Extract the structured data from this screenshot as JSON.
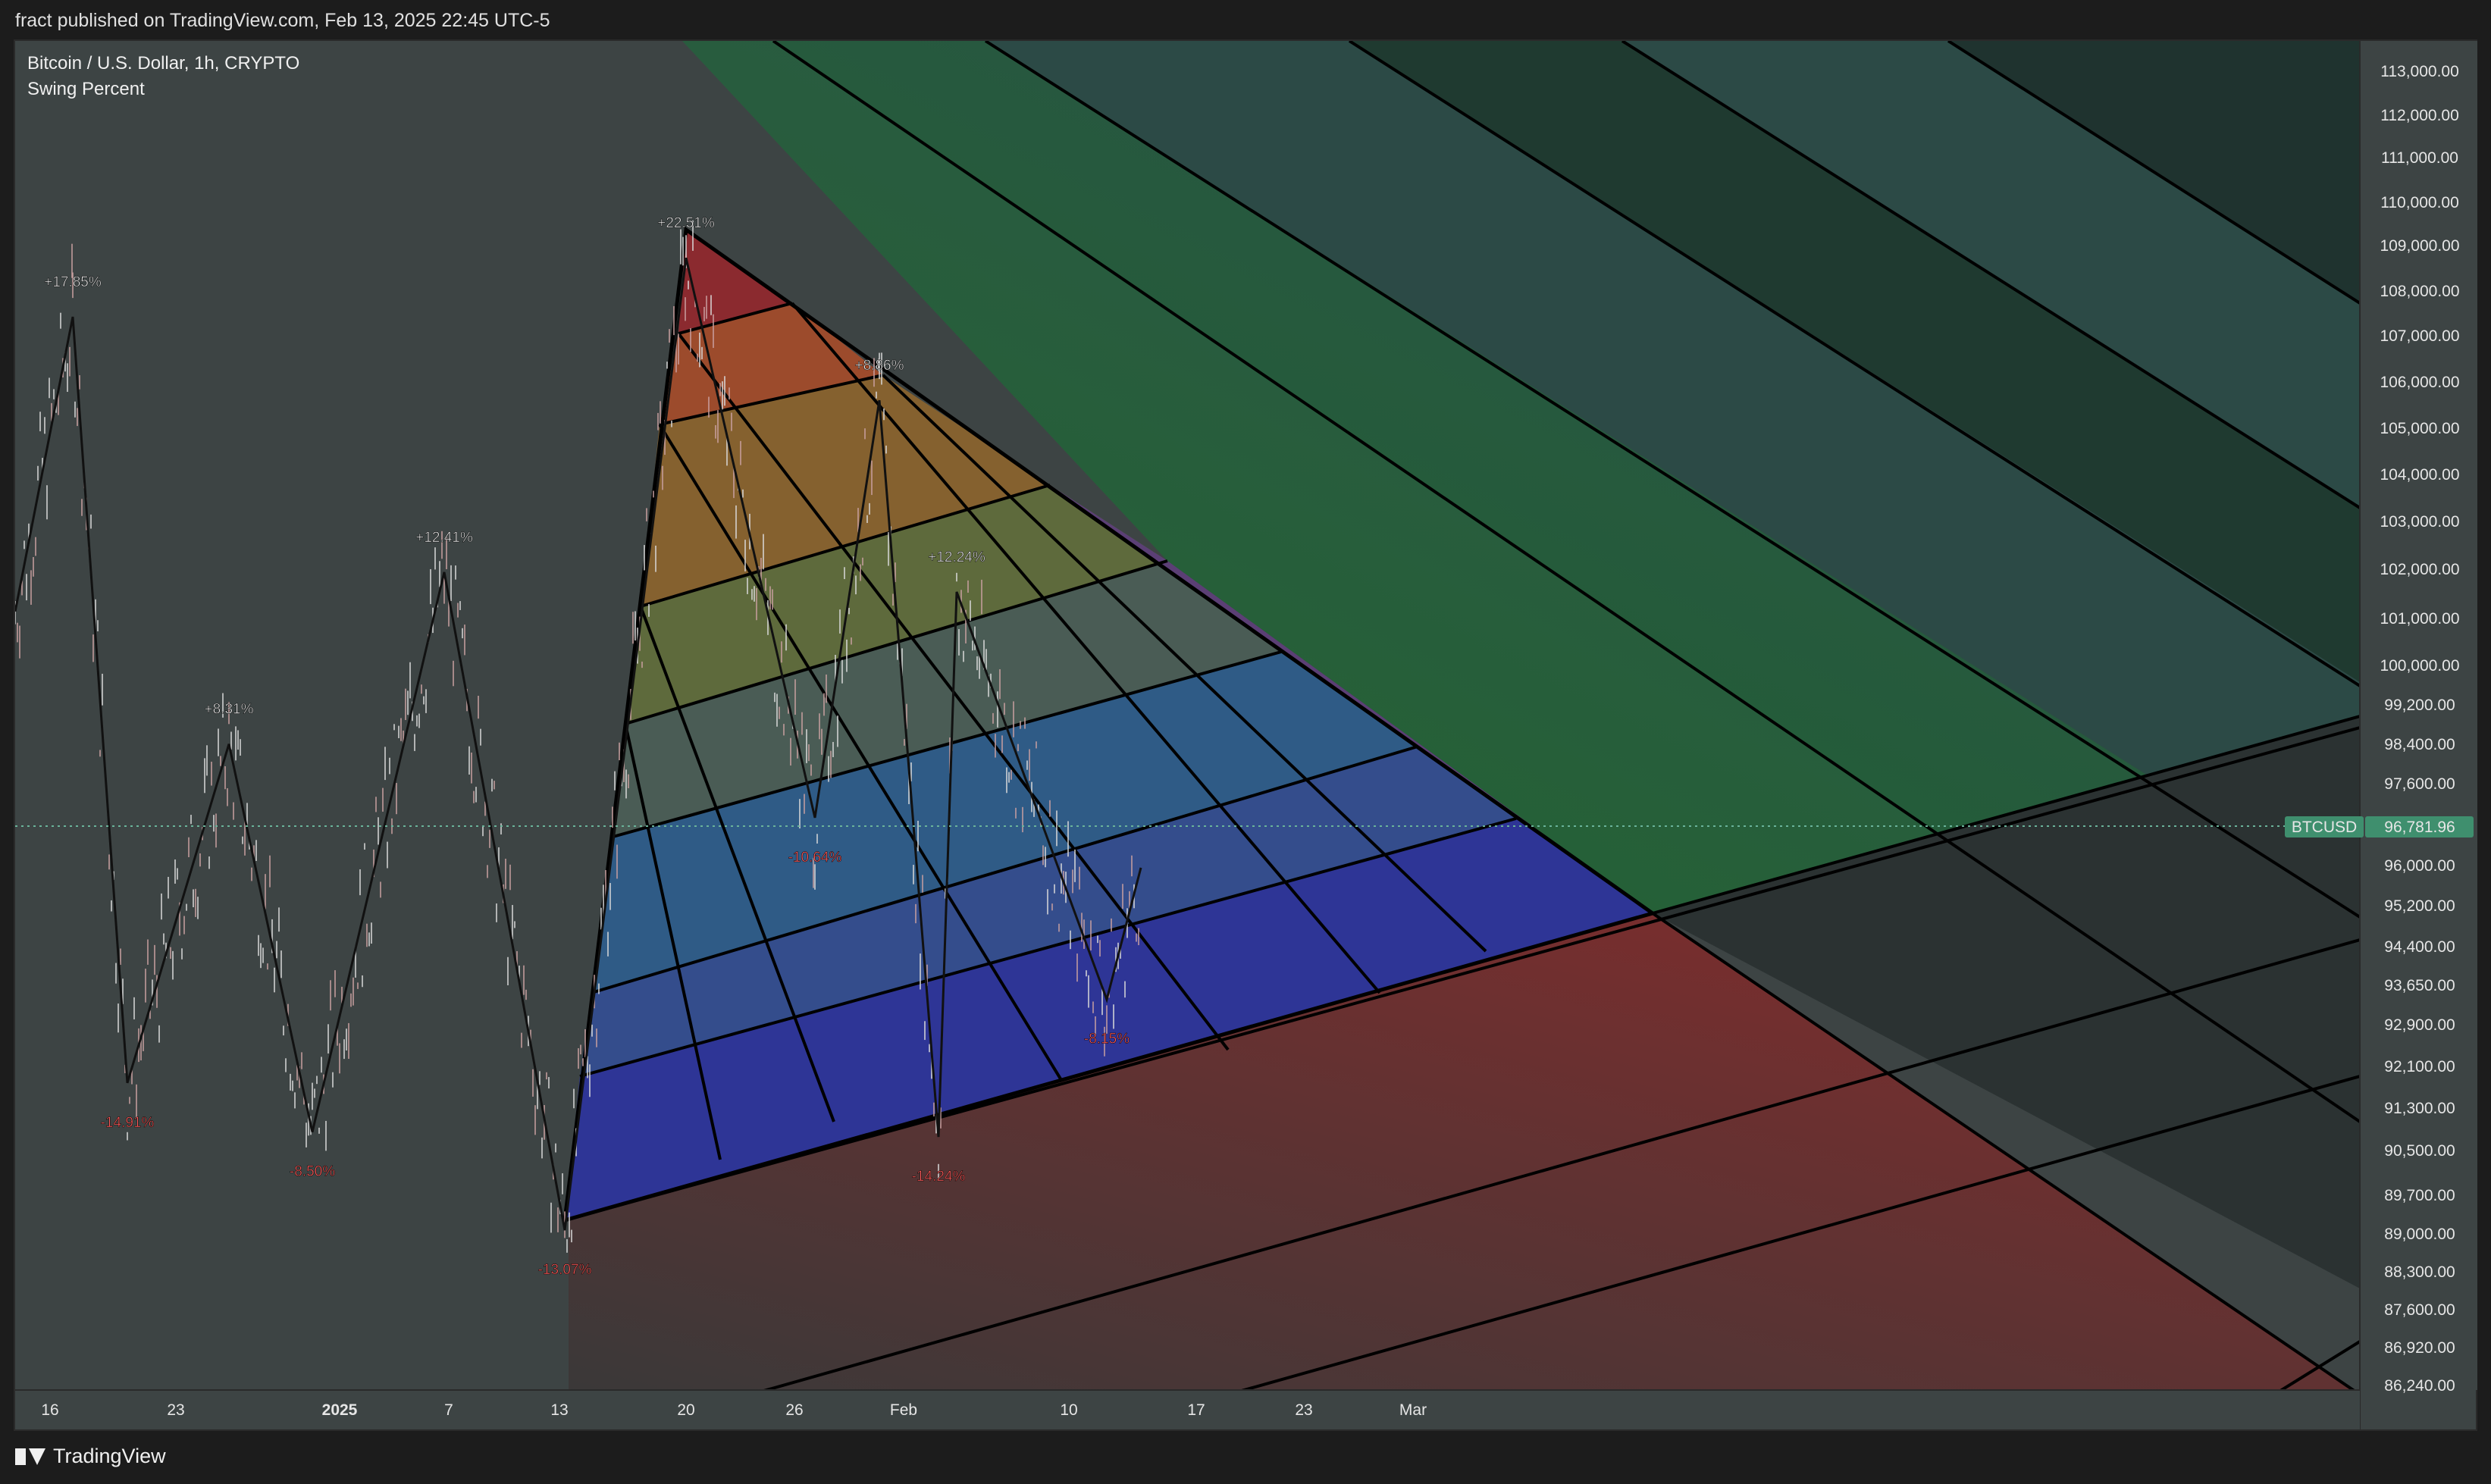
{
  "header": {
    "published_text": "fract published on TradingView.com, Feb 13, 2025 22:45 UTC-5"
  },
  "legend": {
    "symbol": "Bitcoin / U.S. Dollar, 1h, CRYPTO",
    "indicator": "Swing Percent"
  },
  "price_scale": {
    "labels": [
      "113,000.00",
      "112,000.00",
      "111,000.00",
      "110,000.00",
      "109,000.00",
      "108,000.00",
      "107,000.00",
      "106,000.00",
      "105,000.00",
      "104,000.00",
      "103,000.00",
      "102,000.00",
      "101,000.00",
      "100,000.00",
      "99,200.00",
      "98,400.00",
      "97,600.00",
      "96,000.00",
      "95,200.00",
      "94,400.00",
      "93,650.00",
      "92,900.00",
      "92,100.00",
      "91,300.00",
      "90,500.00",
      "89,700.00",
      "89,000.00",
      "88,300.00",
      "87,600.00",
      "86,920.00",
      "86,240.00"
    ],
    "current_symbol_tag": "BTCUSD",
    "current_price": "96,781.96",
    "current_color": "#3f8f6e"
  },
  "time_scale": {
    "labels": [
      "16",
      "23",
      "2025",
      "7",
      "13",
      "20",
      "26",
      "Feb",
      "10",
      "17",
      "23",
      "Mar"
    ]
  },
  "chart_data": {
    "type": "line",
    "title": "Bitcoin / U.S. Dollar, 1h, CRYPTO",
    "indicator": "Swing Percent",
    "x": [
      "16",
      "23",
      "2025",
      "7",
      "13",
      "20",
      "26",
      "Feb",
      "10",
      "17",
      "23",
      "Mar"
    ],
    "swing_labels": [
      {
        "text": "+17.85%",
        "dir": "up"
      },
      {
        "text": "-14.91%",
        "dir": "down"
      },
      {
        "text": "+8.31%",
        "dir": "up"
      },
      {
        "text": "-8.50%",
        "dir": "down"
      },
      {
        "text": "+12.41%",
        "dir": "up"
      },
      {
        "text": "-13.07%",
        "dir": "down"
      },
      {
        "text": "+22.51%",
        "dir": "up"
      },
      {
        "text": "-10.64%",
        "dir": "down"
      },
      {
        "text": "+8.86%",
        "dir": "up"
      },
      {
        "text": "-14.24%",
        "dir": "down"
      },
      {
        "text": "+12.24%",
        "dir": "up"
      },
      {
        "text": "-8.15%",
        "dir": "down"
      }
    ],
    "zigzag_prices": [
      102000,
      108000,
      92400,
      99300,
      91400,
      102800,
      89400,
      109200,
      97800,
      106300,
      91300,
      102400,
      94100,
      96781.96
    ],
    "colors": {
      "up_label": "#e8e8e8",
      "down_label": "#ff5a5a",
      "zigzag": "#111111"
    }
  },
  "footer": {
    "brand": "TradingView",
    "logo_icon": "tradingview-logo-icon"
  }
}
